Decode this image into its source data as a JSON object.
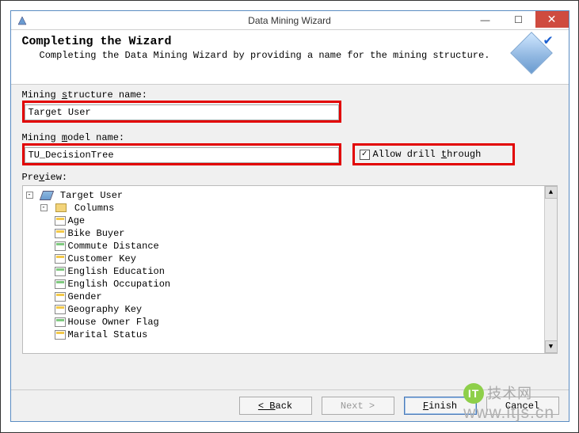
{
  "titlebar": {
    "title": "Data Mining Wizard",
    "min": "—",
    "max": "☐",
    "close": "✕"
  },
  "header": {
    "title": "Completing the Wizard",
    "subtitle": "Completing the Data Mining Wizard by providing a name for the mining structure."
  },
  "fields": {
    "structure_label_pre": "Mining ",
    "structure_label_u": "s",
    "structure_label_post": "tructure name:",
    "structure_value": "Target User",
    "model_label_pre": "Mining ",
    "model_label_u": "m",
    "model_label_post": "odel name:",
    "model_value": "TU_DecisionTree",
    "allow_label_pre": "Allow drill ",
    "allow_label_u": "t",
    "allow_label_post": "hrough",
    "allow_checked": "✓",
    "preview_label_pre": "Pre",
    "preview_label_u": "v",
    "preview_label_post": "iew:"
  },
  "tree": {
    "root": "Target User",
    "columns_label": "Columns",
    "items": [
      "Age",
      "Bike Buyer",
      "Commute Distance",
      "Customer Key",
      "English Education",
      "English Occupation",
      "Gender",
      "Geography Key",
      "House Owner Flag",
      "Marital Status"
    ]
  },
  "buttons": {
    "back": "< Back",
    "next": "Next >",
    "finish": "Finish",
    "cancel": "Cancel"
  },
  "watermark": {
    "logo": "IT",
    "cn": "技术网",
    "url": "www.itjs.cn"
  }
}
